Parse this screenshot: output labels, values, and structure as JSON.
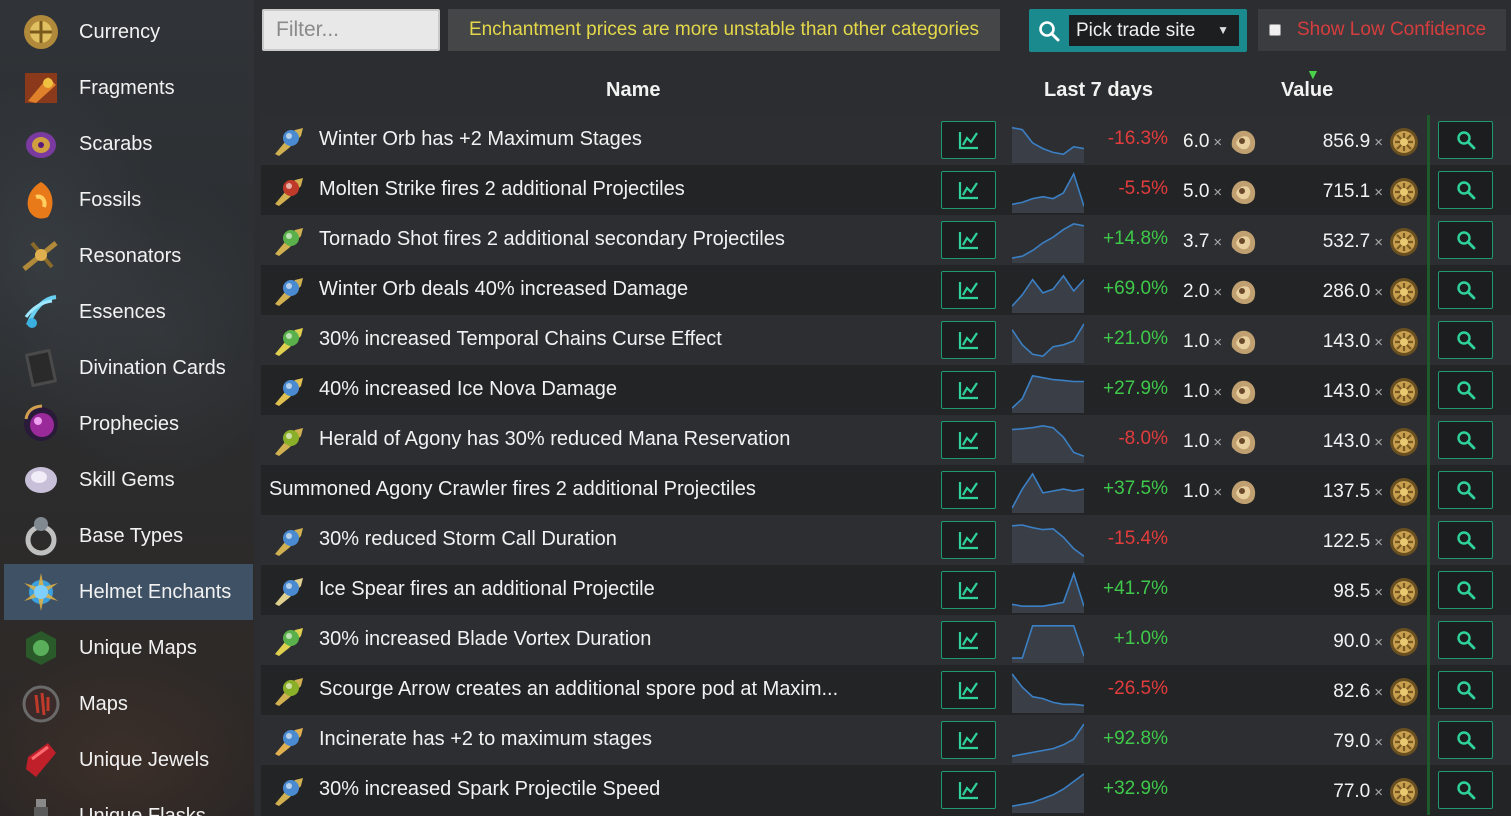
{
  "sidebar": {
    "items": [
      {
        "label": "Currency",
        "icon": "chaos-orb-icon"
      },
      {
        "label": "Fragments",
        "icon": "fragment-icon"
      },
      {
        "label": "Scarabs",
        "icon": "scarab-icon"
      },
      {
        "label": "Fossils",
        "icon": "fossil-icon"
      },
      {
        "label": "Resonators",
        "icon": "resonator-icon"
      },
      {
        "label": "Essences",
        "icon": "essence-icon"
      },
      {
        "label": "Divination Cards",
        "icon": "divination-card-icon"
      },
      {
        "label": "Prophecies",
        "icon": "prophecy-icon"
      },
      {
        "label": "Skill Gems",
        "icon": "skill-gem-icon"
      },
      {
        "label": "Base Types",
        "icon": "ring-icon"
      },
      {
        "label": "Helmet Enchants",
        "icon": "enchant-icon",
        "active": true
      },
      {
        "label": "Unique Maps",
        "icon": "unique-map-icon"
      },
      {
        "label": "Maps",
        "icon": "map-icon"
      },
      {
        "label": "Unique Jewels",
        "icon": "jewel-icon"
      },
      {
        "label": "Unique Flasks",
        "icon": "flask-icon"
      }
    ]
  },
  "toolbar": {
    "filter_placeholder": "Filter...",
    "warning": "Enchantment prices are more unstable than other categories",
    "trade_site": "Pick trade site",
    "low_confidence_label": "Show Low Confidence"
  },
  "table": {
    "headers": {
      "name": "Name",
      "last7": "Last 7 days",
      "value": "Value"
    },
    "rows": [
      {
        "name": "Winter Orb has +2 Maximum Stages",
        "change": "-16.3%",
        "exalt": "6.0",
        "value": "856.9",
        "spark": [
          0.85,
          0.8,
          0.45,
          0.3,
          0.2,
          0.15,
          0.35,
          0.3
        ],
        "has_icon": true
      },
      {
        "name": "Molten Strike fires 2 additional Projectiles",
        "change": "-5.5%",
        "exalt": "5.0",
        "value": "715.1",
        "spark": [
          0.15,
          0.2,
          0.3,
          0.35,
          0.3,
          0.45,
          0.95,
          0.1
        ],
        "has_icon": true
      },
      {
        "name": "Tornado Shot fires 2 additional secondary Projectiles",
        "change": "+14.8%",
        "exalt": "3.7",
        "value": "532.7",
        "spark": [
          0.05,
          0.1,
          0.25,
          0.45,
          0.6,
          0.8,
          0.95,
          0.9
        ],
        "has_icon": true
      },
      {
        "name": "Winter Orb deals 40% increased Damage",
        "change": "+69.0%",
        "exalt": "2.0",
        "value": "286.0",
        "spark": [
          0.1,
          0.4,
          0.8,
          0.45,
          0.55,
          0.9,
          0.5,
          0.8
        ],
        "has_icon": true
      },
      {
        "name": "30% increased Temporal Chains Curse Effect",
        "change": "+21.0%",
        "exalt": "1.0",
        "value": "143.0",
        "spark": [
          0.8,
          0.4,
          0.15,
          0.1,
          0.35,
          0.4,
          0.5,
          0.95
        ],
        "has_icon": true
      },
      {
        "name": "40% increased Ice Nova Damage",
        "change": "+27.9%",
        "exalt": "1.0",
        "value": "143.0",
        "spark": [
          0.05,
          0.3,
          0.9,
          0.85,
          0.8,
          0.78,
          0.75,
          0.75
        ],
        "has_icon": true
      },
      {
        "name": "Herald of Agony has 30% reduced Mana Reservation",
        "change": "-8.0%",
        "exalt": "1.0",
        "value": "143.0",
        "spark": [
          0.8,
          0.82,
          0.85,
          0.9,
          0.85,
          0.6,
          0.2,
          0.1
        ],
        "has_icon": true
      },
      {
        "name": "Summoned Agony Crawler fires 2 additional Projectiles",
        "change": "+37.5%",
        "exalt": "1.0",
        "value": "137.5",
        "spark": [
          0.05,
          0.55,
          0.95,
          0.45,
          0.5,
          0.55,
          0.5,
          0.55
        ],
        "has_icon": false
      },
      {
        "name": "30% reduced Storm Call Duration",
        "change": "-15.4%",
        "exalt": "",
        "value": "122.5",
        "spark": [
          0.9,
          0.92,
          0.85,
          0.8,
          0.82,
          0.6,
          0.3,
          0.1
        ],
        "has_icon": true
      },
      {
        "name": "Ice Spear fires an additional Projectile",
        "change": "+41.7%",
        "exalt": "",
        "value": "98.5",
        "spark": [
          0.15,
          0.1,
          0.1,
          0.1,
          0.15,
          0.2,
          0.95,
          0.1
        ],
        "has_icon": true
      },
      {
        "name": "30% increased Blade Vortex Duration",
        "change": "+1.0%",
        "exalt": "",
        "value": "90.0",
        "spark": [
          0.05,
          0.05,
          0.9,
          0.9,
          0.9,
          0.9,
          0.9,
          0.1
        ],
        "has_icon": true
      },
      {
        "name": "Scourge Arrow creates an additional spore pod at Maxim...",
        "change": "-26.5%",
        "exalt": "",
        "value": "82.6",
        "spark": [
          0.95,
          0.6,
          0.35,
          0.3,
          0.2,
          0.15,
          0.15,
          0.12
        ],
        "has_icon": true
      },
      {
        "name": "Incinerate has +2 to maximum stages",
        "change": "+92.8%",
        "exalt": "",
        "value": "79.0",
        "spark": [
          0.1,
          0.15,
          0.2,
          0.25,
          0.3,
          0.4,
          0.55,
          0.95
        ],
        "has_icon": true
      },
      {
        "name": "30% increased Spark Projectile Speed",
        "change": "+32.9%",
        "exalt": "",
        "value": "77.0",
        "spark": [
          0.1,
          0.15,
          0.2,
          0.3,
          0.4,
          0.55,
          0.75,
          0.95
        ],
        "has_icon": true
      }
    ]
  },
  "colors": {
    "positive": "#3ec94a",
    "negative": "#e23c3c",
    "accent": "#1a8a8e",
    "active_nav": "#465f78",
    "spark_line": "#3b7fc4",
    "warning_text": "#e4d84a"
  }
}
